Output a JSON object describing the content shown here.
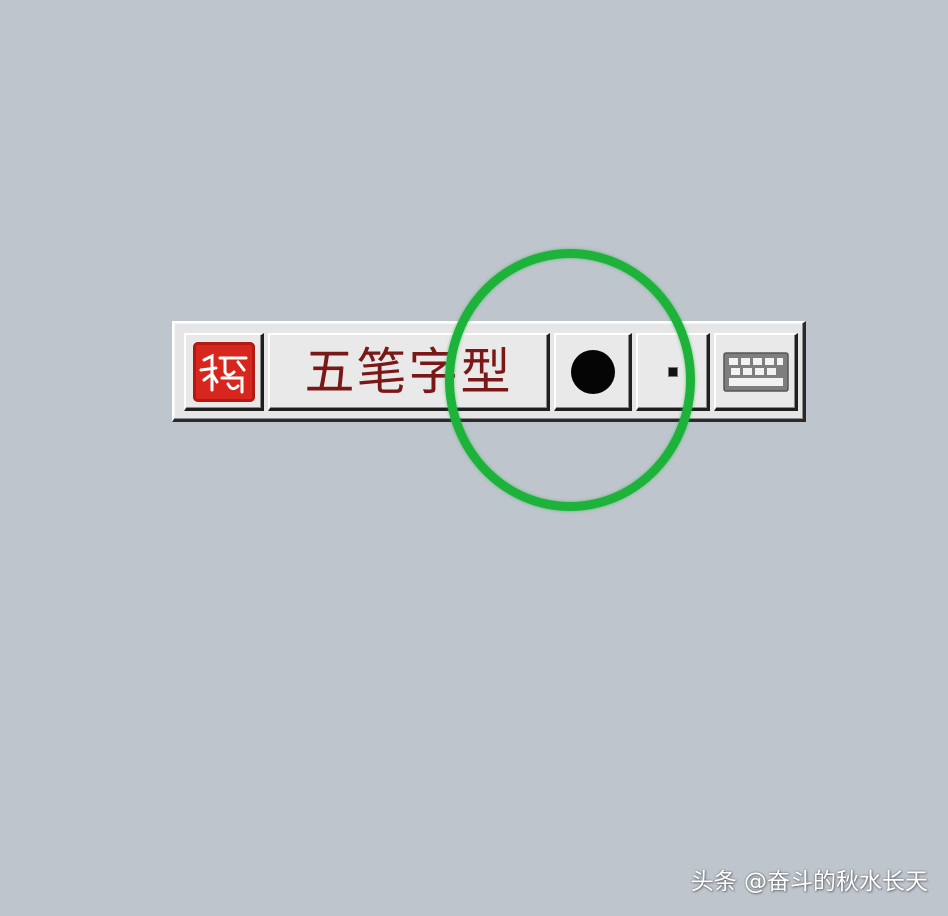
{
  "ime_toolbar": {
    "logo": {
      "icon": "ime-seal-logo-icon",
      "color": "#d7261e"
    },
    "mode_label": "五笔字型",
    "width_toggle": {
      "icon": "full-width-dot-icon"
    },
    "punctuation_toggle": {
      "icon": "punctuation-dot-icon"
    },
    "soft_keyboard": {
      "icon": "keyboard-icon"
    }
  },
  "annotation": {
    "shape": "circle",
    "color": "#1db33a"
  },
  "watermark": "头条 @奋斗的秋水长天"
}
